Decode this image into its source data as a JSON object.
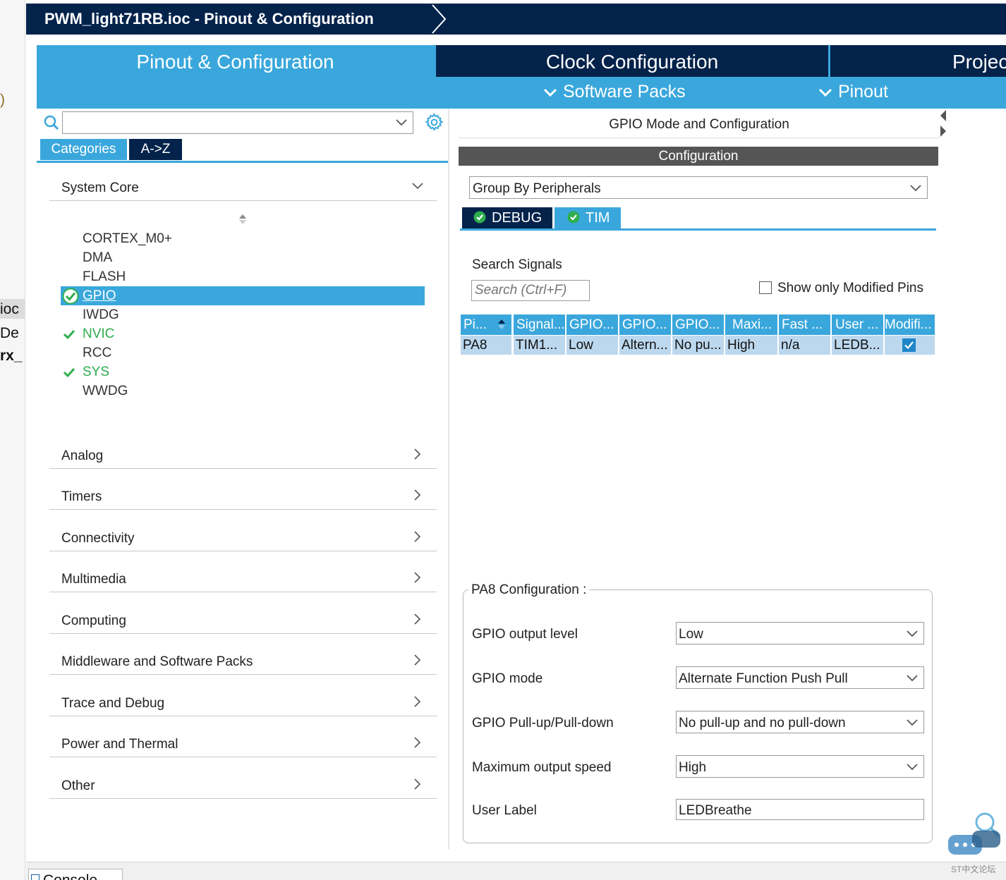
{
  "gutter": {
    "frag1": "ioc",
    "frag2": "De",
    "frag3": "rx_",
    "frag4": ")"
  },
  "window": {
    "title": "PWM_light71RB.ioc - Pinout & Configuration"
  },
  "top_tabs": [
    {
      "label": "Pinout & Configuration"
    },
    {
      "label": "Clock Configuration"
    },
    {
      "label": "Projec"
    }
  ],
  "sub_tabs": [
    {
      "label": "Software Packs"
    },
    {
      "label": "Pinout"
    }
  ],
  "left": {
    "search_value": "",
    "tabs": [
      {
        "label": "Categories"
      },
      {
        "label": "A->Z"
      }
    ],
    "system_core": {
      "label": "System Core",
      "items": [
        {
          "label": "CORTEX_M0+",
          "status": "none"
        },
        {
          "label": "DMA",
          "status": "none"
        },
        {
          "label": "FLASH",
          "status": "none"
        },
        {
          "label": "GPIO",
          "status": "selected-ok"
        },
        {
          "label": "IWDG",
          "status": "none"
        },
        {
          "label": "NVIC",
          "status": "ok"
        },
        {
          "label": "RCC",
          "status": "none"
        },
        {
          "label": "SYS",
          "status": "ok"
        },
        {
          "label": "WWDG",
          "status": "none"
        }
      ]
    },
    "categories": [
      {
        "label": "Analog"
      },
      {
        "label": "Timers"
      },
      {
        "label": "Connectivity"
      },
      {
        "label": "Multimedia"
      },
      {
        "label": "Computing"
      },
      {
        "label": "Middleware and Software Packs"
      },
      {
        "label": "Trace and Debug"
      },
      {
        "label": "Power and Thermal"
      },
      {
        "label": "Other"
      }
    ]
  },
  "right": {
    "title": "GPIO Mode and Configuration",
    "config_bar": "Configuration",
    "group_by": "Group By Peripherals",
    "tabs": [
      {
        "label": "DEBUG"
      },
      {
        "label": "TIM"
      }
    ],
    "search_label": "Search Signals",
    "search_placeholder": "Search (Ctrl+F)",
    "show_modified_label": "Show only Modified Pins",
    "show_modified_checked": false,
    "table": {
      "headers": [
        "Pi...",
        "Signal...",
        "GPIO...",
        "GPIO...",
        "GPIO...",
        "Maxi...",
        "Fast ...",
        "User ...",
        "Modifi..."
      ],
      "rows": [
        {
          "cells": [
            "PA8",
            "TIM1...",
            "Low",
            "Altern...",
            "No pu...",
            "High",
            "n/a",
            "LEDB..."
          ],
          "modified": true
        }
      ]
    },
    "pa8": {
      "title": "PA8 Configuration :",
      "fields": [
        {
          "label": "GPIO output level",
          "value": "Low"
        },
        {
          "label": "GPIO mode",
          "value": "Alternate Function Push Pull"
        },
        {
          "label": "GPIO Pull-up/Pull-down",
          "value": "No pull-up and no pull-down"
        },
        {
          "label": "Maximum output speed",
          "value": "High"
        },
        {
          "label": "User Label",
          "value": "LEDBreathe"
        }
      ]
    }
  },
  "console": {
    "label": "Console"
  },
  "watermark": {
    "text": "ST中文论坛"
  },
  "colors": {
    "navy": "#03234b",
    "accent": "#3aa7dc",
    "ok_green": "#2fae4e",
    "row_bg": "#bcd8ef"
  }
}
